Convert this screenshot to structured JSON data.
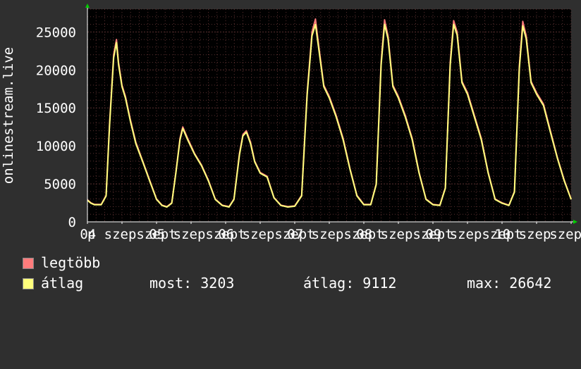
{
  "colors": {
    "background": "#2f2f2f",
    "plot_bg": "#000000",
    "grid": "#5a3030",
    "axis": "#ffffff",
    "arrow": "#00cc00",
    "max_line": "#ff7c7c",
    "avg_line": "#ffff7c"
  },
  "legend": {
    "items": [
      {
        "label": "legtöbb",
        "color": "#ff7c7c"
      },
      {
        "label": "átlag",
        "color": "#ffff7c"
      }
    ],
    "stats": {
      "now": "most: 3203",
      "avg": "átlag: 9112",
      "max": "max: 26642"
    }
  },
  "chart_data": {
    "type": "line",
    "ylabel": "onlinestream.live",
    "ylim": [
      0,
      28000
    ],
    "yticks": [
      0,
      5000,
      10000,
      15000,
      20000,
      25000
    ],
    "xlim": [
      0,
      7
    ],
    "xtick_labels": [
      {
        "x": 0.0,
        "text": "p"
      },
      {
        "x": 0.3,
        "text": "04 szep"
      },
      {
        "x": 1.3,
        "text": "05 szep"
      },
      {
        "x": 2.3,
        "text": "06 szep"
      },
      {
        "x": 3.3,
        "text": "07 szep"
      },
      {
        "x": 4.3,
        "text": "08 szep"
      },
      {
        "x": 5.3,
        "text": "09 szep"
      },
      {
        "x": 6.3,
        "text": "10 szep"
      },
      {
        "x": 6.92,
        "text": "szep"
      }
    ],
    "xtick_words": [
      {
        "x": 1.0,
        "text": "szept"
      },
      {
        "x": 2.0,
        "text": "szept"
      },
      {
        "x": 3.0,
        "text": "szept"
      },
      {
        "x": 4.0,
        "text": "szept"
      },
      {
        "x": 5.0,
        "text": "szept"
      },
      {
        "x": 6.0,
        "text": "szept"
      }
    ],
    "series": [
      {
        "name": "legtöbb",
        "color": "#ff7c7c",
        "x": [
          0,
          0.05,
          0.1,
          0.2,
          0.27,
          0.32,
          0.38,
          0.42,
          0.45,
          0.5,
          0.55,
          0.62,
          0.7,
          0.8,
          0.9,
          1.0,
          1.08,
          1.15,
          1.22,
          1.28,
          1.34,
          1.38,
          1.45,
          1.55,
          1.65,
          1.75,
          1.85,
          1.95,
          2.05,
          2.12,
          2.2,
          2.25,
          2.3,
          2.36,
          2.42,
          2.5,
          2.6,
          2.7,
          2.8,
          2.9,
          3.0,
          3.1,
          3.18,
          3.25,
          3.3,
          3.35,
          3.42,
          3.5,
          3.6,
          3.7,
          3.8,
          3.9,
          4.0,
          4.1,
          4.18,
          4.25,
          4.3,
          4.35,
          4.42,
          4.5,
          4.6,
          4.7,
          4.8,
          4.9,
          5.0,
          5.1,
          5.18,
          5.25,
          5.3,
          5.35,
          5.42,
          5.5,
          5.6,
          5.7,
          5.8,
          5.9,
          6.0,
          6.1,
          6.18,
          6.25,
          6.3,
          6.35,
          6.42,
          6.5,
          6.6,
          6.7,
          6.8,
          6.9,
          7.0
        ],
        "y": [
          2900,
          2500,
          2300,
          2300,
          3500,
          13000,
          22000,
          24000,
          21000,
          18000,
          16500,
          13500,
          10500,
          8000,
          5500,
          3000,
          2200,
          2000,
          2500,
          6500,
          11000,
          12500,
          11000,
          9000,
          7500,
          5500,
          3000,
          2200,
          2000,
          3000,
          9000,
          11500,
          12000,
          10500,
          8000,
          6500,
          6000,
          3200,
          2200,
          2000,
          2100,
          3500,
          17000,
          25000,
          26700,
          23000,
          18000,
          16500,
          14000,
          11000,
          7000,
          3500,
          2300,
          2300,
          5000,
          21000,
          26600,
          24500,
          18000,
          16500,
          14000,
          11000,
          6500,
          3000,
          2300,
          2200,
          4500,
          21000,
          26500,
          25000,
          18500,
          17000,
          14000,
          11000,
          6500,
          3000,
          2500,
          2200,
          4000,
          20500,
          26400,
          24500,
          18500,
          17000,
          15500,
          12000,
          8500,
          5500,
          3000
        ]
      },
      {
        "name": "átlag",
        "color": "#ffff7c",
        "x": [
          0,
          0.05,
          0.1,
          0.2,
          0.27,
          0.32,
          0.38,
          0.42,
          0.45,
          0.5,
          0.55,
          0.62,
          0.7,
          0.8,
          0.9,
          1.0,
          1.08,
          1.15,
          1.22,
          1.28,
          1.34,
          1.38,
          1.45,
          1.55,
          1.65,
          1.75,
          1.85,
          1.95,
          2.05,
          2.12,
          2.2,
          2.25,
          2.3,
          2.36,
          2.42,
          2.5,
          2.6,
          2.7,
          2.8,
          2.9,
          3.0,
          3.1,
          3.18,
          3.25,
          3.3,
          3.35,
          3.42,
          3.5,
          3.6,
          3.7,
          3.8,
          3.9,
          4.0,
          4.1,
          4.18,
          4.25,
          4.3,
          4.35,
          4.42,
          4.5,
          4.6,
          4.7,
          4.8,
          4.9,
          5.0,
          5.1,
          5.18,
          5.25,
          5.3,
          5.35,
          5.42,
          5.5,
          5.6,
          5.7,
          5.8,
          5.9,
          6.0,
          6.1,
          6.18,
          6.25,
          6.3,
          6.35,
          6.42,
          6.5,
          6.6,
          6.7,
          6.8,
          6.9,
          7.0
        ],
        "y": [
          2850,
          2450,
          2250,
          2250,
          3400,
          12700,
          21600,
          23600,
          20700,
          17800,
          16300,
          13300,
          10300,
          7900,
          5400,
          2950,
          2150,
          1950,
          2450,
          6400,
          10800,
          12300,
          10800,
          8900,
          7400,
          5400,
          2950,
          2150,
          1950,
          2950,
          8800,
          11300,
          11800,
          10300,
          7900,
          6400,
          5900,
          3150,
          2150,
          1950,
          2050,
          3400,
          16700,
          24500,
          26000,
          22600,
          17800,
          16300,
          13800,
          10800,
          6900,
          3400,
          2250,
          2250,
          4900,
          20600,
          26000,
          24100,
          17800,
          16300,
          13800,
          10800,
          6400,
          2950,
          2250,
          2150,
          4400,
          20600,
          26000,
          24600,
          18300,
          16800,
          13800,
          10800,
          6400,
          2950,
          2450,
          2150,
          3900,
          20100,
          25800,
          24100,
          18300,
          16800,
          15300,
          11800,
          8400,
          5400,
          2950
        ]
      }
    ]
  }
}
